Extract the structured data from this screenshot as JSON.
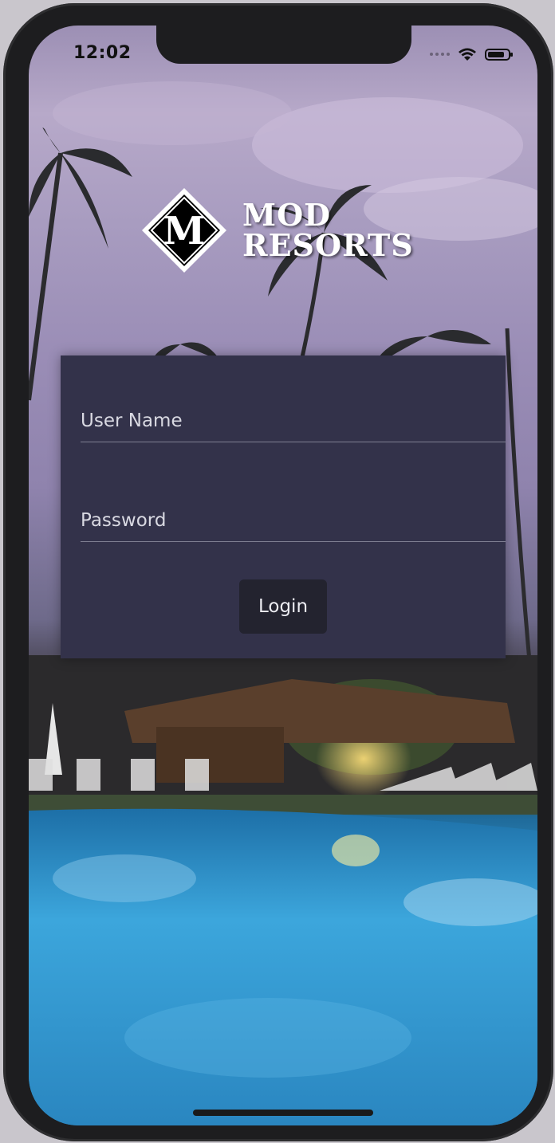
{
  "status_bar": {
    "time": "12:02"
  },
  "logo": {
    "mark_letter": "M",
    "line1": "MOD",
    "line2": "RESORTS"
  },
  "login_form": {
    "username_placeholder": "User Name",
    "password_placeholder": "Password",
    "login_label": "Login"
  },
  "icons": {
    "signal": "cellular-signal-icon",
    "wifi": "wifi-icon",
    "battery": "battery-icon"
  },
  "colors": {
    "panel": "#33324a",
    "button": "#23232f",
    "text": "#e8e8ef"
  }
}
